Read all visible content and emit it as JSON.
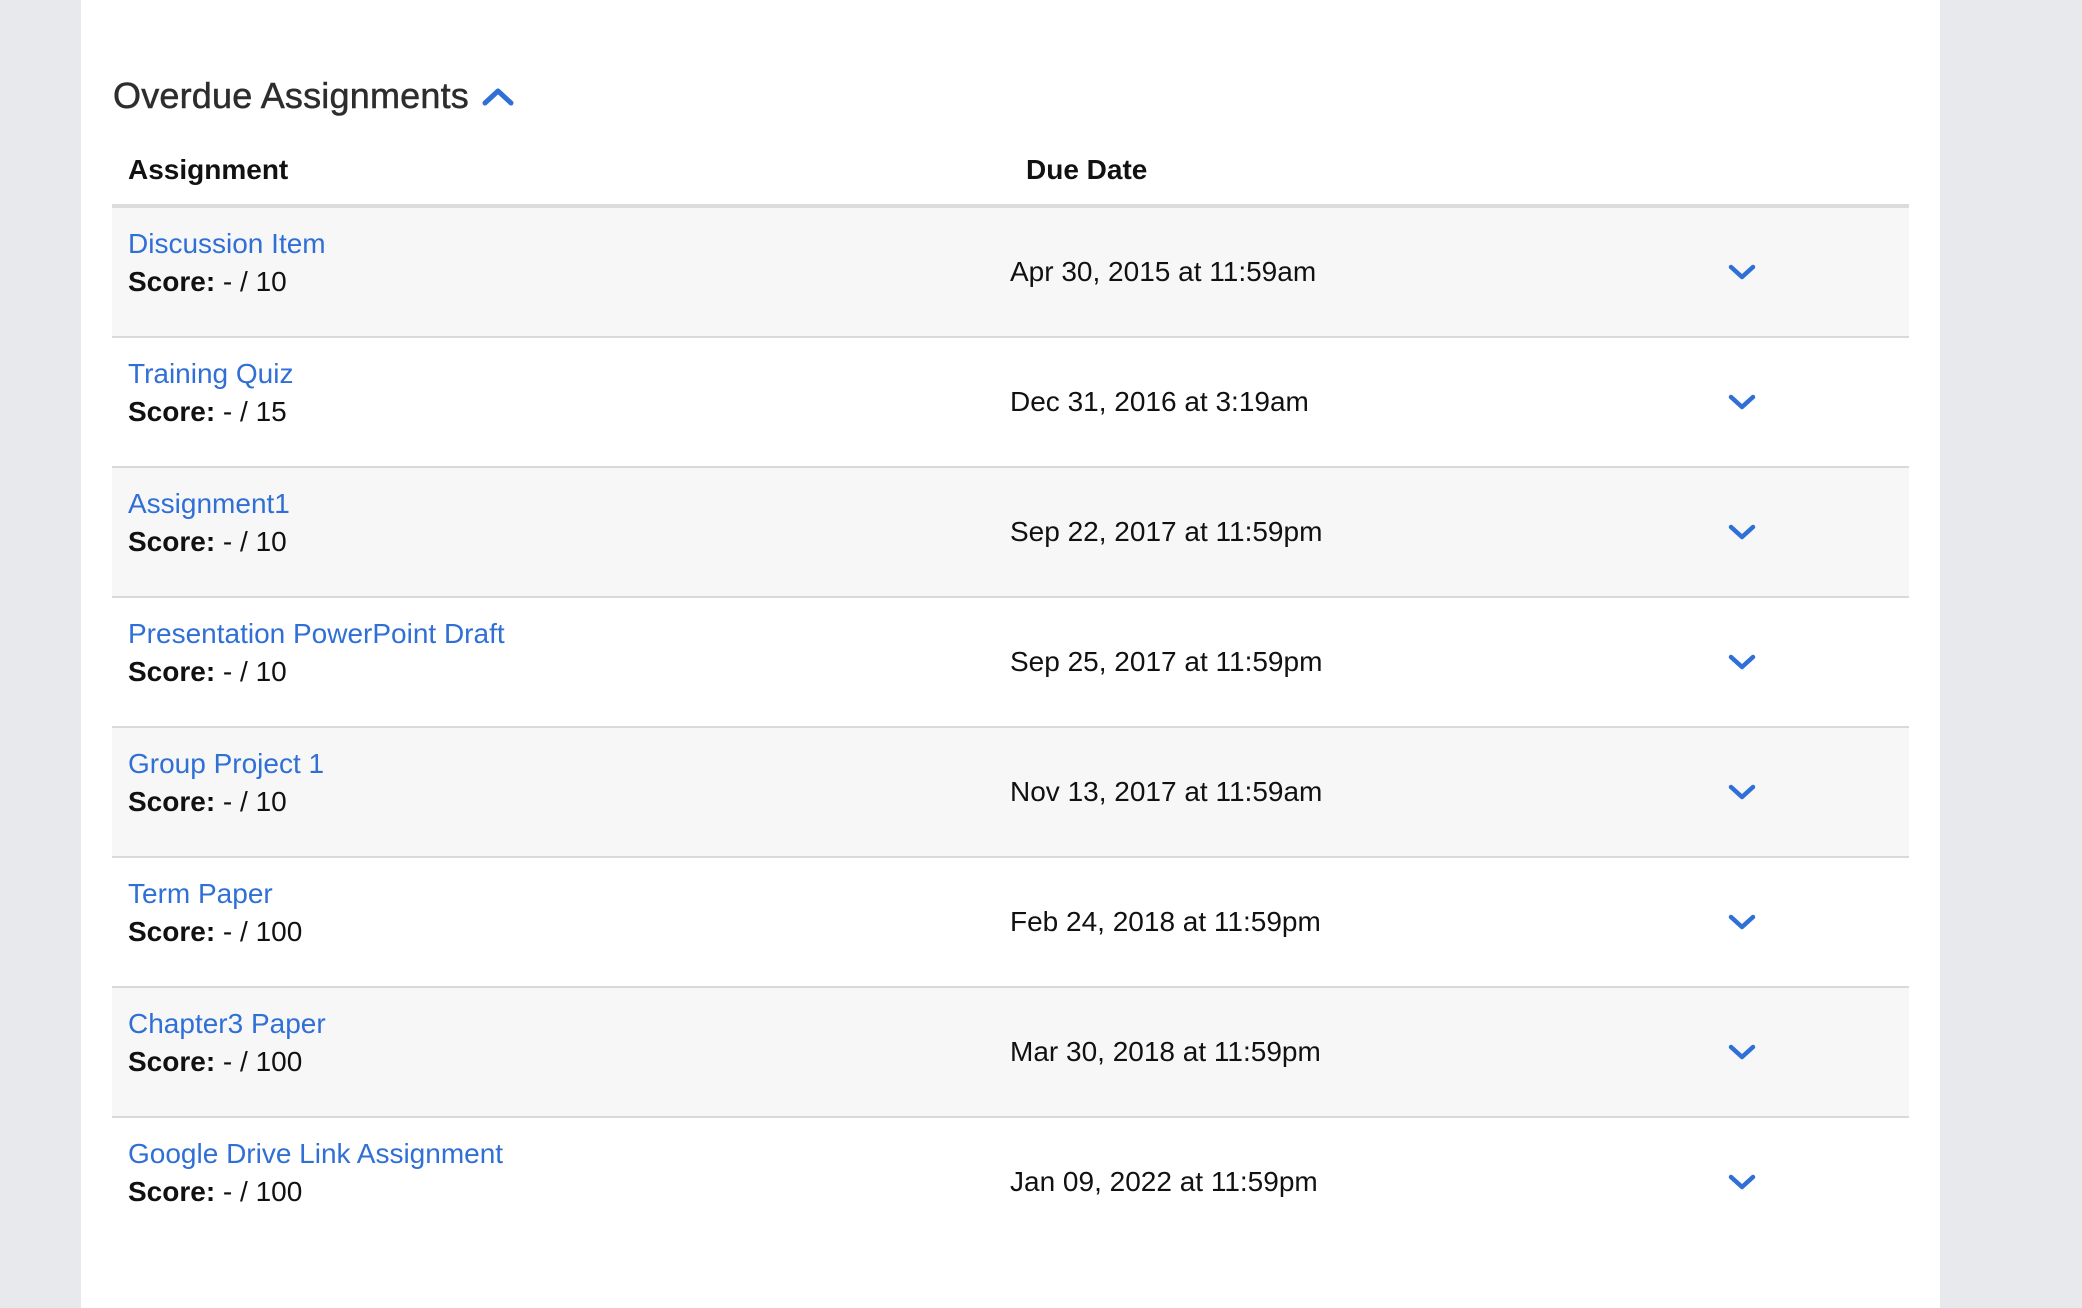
{
  "section": {
    "title": "Overdue Assignments",
    "toggle_icon": "chevron-up-icon"
  },
  "columns": {
    "assignment": "Assignment",
    "due_date": "Due Date"
  },
  "score_label": "Score:",
  "accent_color": "#2f6fd6",
  "rows": [
    {
      "name": "Discussion Item",
      "score": " - / 10",
      "due": "Apr 30, 2015 at 11:59am"
    },
    {
      "name": "Training Quiz",
      "score": " - / 15",
      "due": "Dec 31, 2016 at 3:19am"
    },
    {
      "name": "Assignment1",
      "score": " - / 10",
      "due": "Sep 22, 2017 at 11:59pm"
    },
    {
      "name": "Presentation PowerPoint Draft",
      "score": " - / 10",
      "due": "Sep 25, 2017 at 11:59pm"
    },
    {
      "name": "Group Project 1",
      "score": " - / 10",
      "due": "Nov 13, 2017 at 11:59am"
    },
    {
      "name": "Term Paper",
      "score": " - / 100",
      "due": "Feb 24, 2018 at 11:59pm"
    },
    {
      "name": "Chapter3 Paper",
      "score": " - / 100",
      "due": "Mar 30, 2018 at 11:59pm"
    },
    {
      "name": "Google Drive Link Assignment",
      "score": " - / 100",
      "due": "Jan 09, 2022 at 11:59pm"
    }
  ]
}
